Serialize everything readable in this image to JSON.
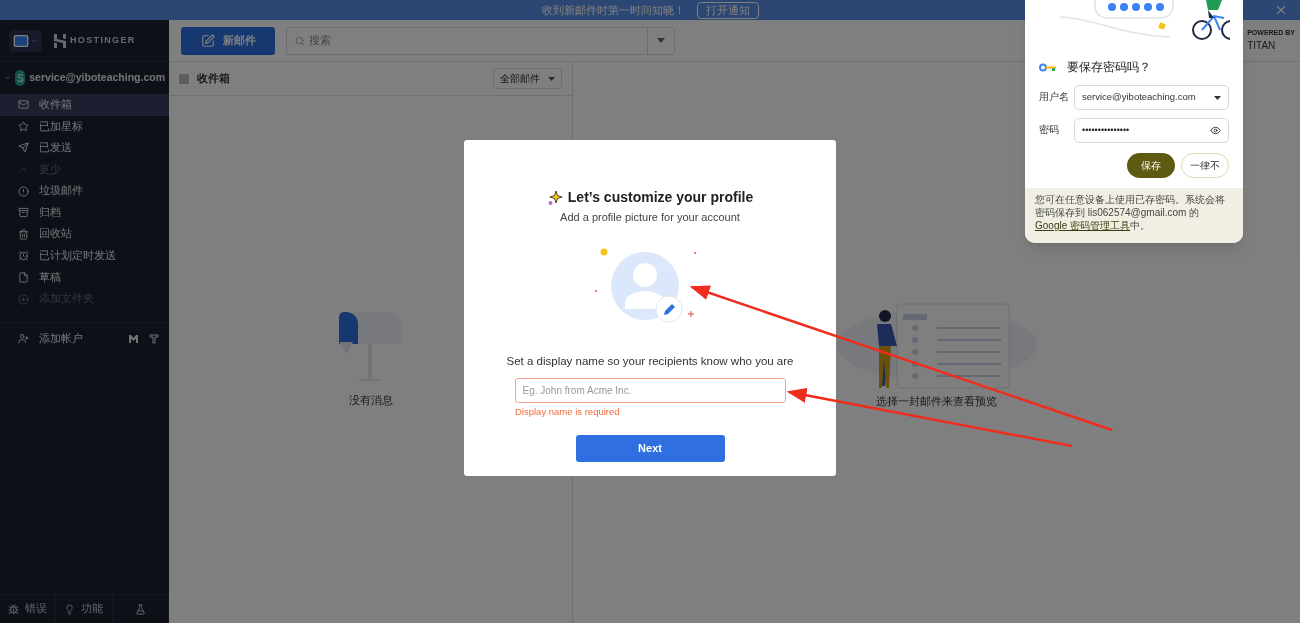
{
  "banner": {
    "text": "收到新邮件时第一时间知晓！",
    "button": "打开通知"
  },
  "brand": "HOSTINGER",
  "compose": "新邮件",
  "search": {
    "placeholder": "搜索"
  },
  "powered": {
    "by": "POWERED BY",
    "name": "TITAN"
  },
  "account": {
    "avatar": "S",
    "email": "service@yiboteaching.com",
    "expanded": true
  },
  "folders": [
    {
      "label": "收件箱",
      "kind": "inbox",
      "selected": true,
      "muted": false
    },
    {
      "label": "已加星标",
      "kind": "star",
      "selected": false,
      "muted": false
    },
    {
      "label": "已发送",
      "kind": "sent",
      "selected": false,
      "muted": false
    },
    {
      "label": "更少",
      "kind": "less",
      "selected": false,
      "muted": true
    },
    {
      "label": "垃圾邮件",
      "kind": "spam",
      "selected": false,
      "muted": false
    },
    {
      "label": "归档",
      "kind": "archive",
      "selected": false,
      "muted": false
    },
    {
      "label": "回收站",
      "kind": "trash",
      "selected": false,
      "muted": false
    },
    {
      "label": "已计划定时发送",
      "kind": "scheduled",
      "selected": false,
      "muted": false
    },
    {
      "label": "草稿",
      "kind": "drafts",
      "selected": false,
      "muted": false
    },
    {
      "label": "添加文件夹",
      "kind": "add",
      "selected": false,
      "muted": true
    }
  ],
  "add_account": "添加帐户",
  "footer": [
    {
      "label": "错误",
      "kind": "bug"
    },
    {
      "label": "功能",
      "kind": "idea"
    },
    {
      "kind": "lab"
    }
  ],
  "list": {
    "checked": false,
    "title": "收件箱",
    "filter": "全部邮件",
    "empty": "没有消息"
  },
  "preview": {
    "empty": "选择一封邮件来查看预览"
  },
  "modal": {
    "title": "Let’s customize your profile",
    "subtitle": "Add a profile picture for your account",
    "prompt": "Set a display name so your recipients know who you are",
    "placeholder": "Eg. John from Acme Inc.",
    "invalid": true,
    "error": "Display name is required",
    "button": "Next"
  },
  "password_prompt": {
    "title": "要保存密码吗？",
    "username_label": "用户名",
    "username": "service@yiboteaching.com",
    "password_label": "密码",
    "password": "•••••••••••••••",
    "save": "保存",
    "never": "一律不",
    "note_before": "您可在任意设备上使用已存密码。系统会将密码保存到 lis062574@gmail.com 的 ",
    "link": "Google 密码管理工具",
    "note_after": "中。"
  }
}
